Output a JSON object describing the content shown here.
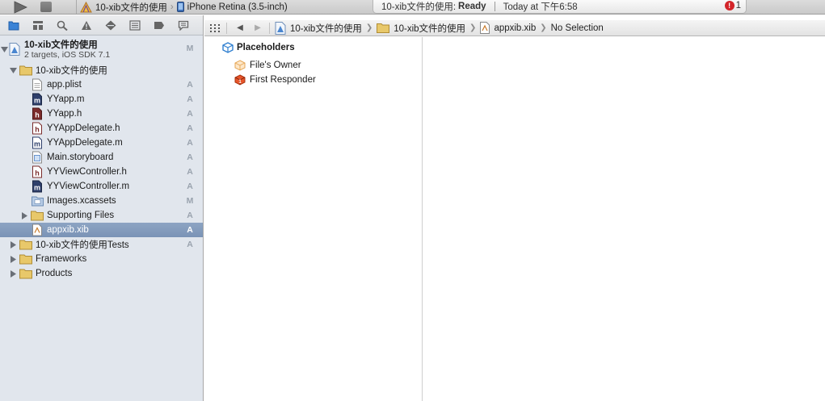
{
  "toolbar": {
    "scheme_name": "10-xib文件的使用",
    "destination": "iPhone Retina (3.5-inch)",
    "activity_prefix": "10-xib文件的使用:",
    "activity_status": "Ready",
    "activity_time": "Today at 下午6:58",
    "issue_count": "1"
  },
  "navigator": {
    "tabs": [
      "project-navigator-icon",
      "symbol-navigator-icon",
      "find-navigator-icon",
      "issue-navigator-icon",
      "test-navigator-icon",
      "debug-navigator-icon",
      "breakpoint-navigator-icon",
      "log-navigator-icon"
    ],
    "project": {
      "name": "10-xib文件的使用",
      "subtitle": "2 targets, iOS SDK 7.1",
      "status": "M"
    },
    "items": [
      {
        "label": "10-xib文件的使用",
        "status": ""
      },
      {
        "label": "app.plist",
        "status": "A"
      },
      {
        "label": "YYapp.m",
        "status": "A"
      },
      {
        "label": "YYapp.h",
        "status": "A"
      },
      {
        "label": "YYAppDelegate.h",
        "status": "A"
      },
      {
        "label": "YYAppDelegate.m",
        "status": "A"
      },
      {
        "label": "Main.storyboard",
        "status": "A"
      },
      {
        "label": "YYViewController.h",
        "status": "A"
      },
      {
        "label": "YYViewController.m",
        "status": "A"
      },
      {
        "label": "Images.xcassets",
        "status": "M"
      },
      {
        "label": "Supporting Files",
        "status": "A"
      },
      {
        "label": "appxib.xib",
        "status": "A"
      },
      {
        "label": "10-xib文件的使用Tests",
        "status": "A"
      },
      {
        "label": "Frameworks",
        "status": ""
      },
      {
        "label": "Products",
        "status": ""
      }
    ]
  },
  "jumpbar": {
    "items": [
      "10-xib文件的使用",
      "10-xib文件的使用",
      "appxib.xib",
      "No Selection"
    ]
  },
  "outline": {
    "heading": "Placeholders",
    "items": [
      "File's Owner",
      "First Responder"
    ]
  },
  "colors": {
    "sidebar_bg": "#e1e6ed",
    "selection": "#7f97b9",
    "folder": "#e8c86a",
    "header_h": "#7a2a2a",
    "impl_m": "#2a3a6a",
    "error": "#d3252a"
  }
}
